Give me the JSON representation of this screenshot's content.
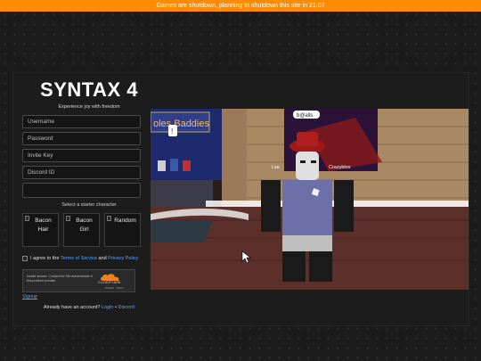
{
  "banner": {
    "text": "Games are shutdown, planning to shutdown this site in 21:07"
  },
  "brand": {
    "title": "SYNTAX 4",
    "subtitle": "Experience joy with freedom"
  },
  "form": {
    "username_placeholder": "Username",
    "password_placeholder": "Password",
    "invite_placeholder": "Invite Key",
    "discord_placeholder": "Discord ID",
    "extra_value": "",
    "starter_label": "Select a starter character",
    "characters": [
      {
        "label": "Bacon Hair",
        "icon": "broken-image-icon"
      },
      {
        "label": "Bacon Girl",
        "icon": "broken-image-icon"
      },
      {
        "label": "Random",
        "icon": "broken-image-icon"
      }
    ],
    "agree_prefix": "I agree to the",
    "terms_link": "Terms of Service",
    "agree_and": "and",
    "privacy_link": "Privacy Policy",
    "signup_label": "Signup",
    "already_text": "Already have an account?",
    "login_link": "Login",
    "separator": "•",
    "discord_link": "Discord"
  },
  "captcha": {
    "message": "Invalid domain. Contact the Site Administrator if this problem persists.",
    "provider": "CLOUDFLARE",
    "links": "Privacy · Terms",
    "logo_icon": "cloudflare-cloud-icon"
  },
  "screenshot": {
    "sign_text": "oles   Baddies",
    "top_nametag": "b@alls",
    "player_left": "Lse",
    "player_right": "Crazyblox",
    "chat_bubble": "!",
    "colors": {
      "sky": "#1e2a6e",
      "wall": "#9a7a58",
      "floor": "#5b2f2a",
      "shirt": "#6d6fa8"
    }
  }
}
